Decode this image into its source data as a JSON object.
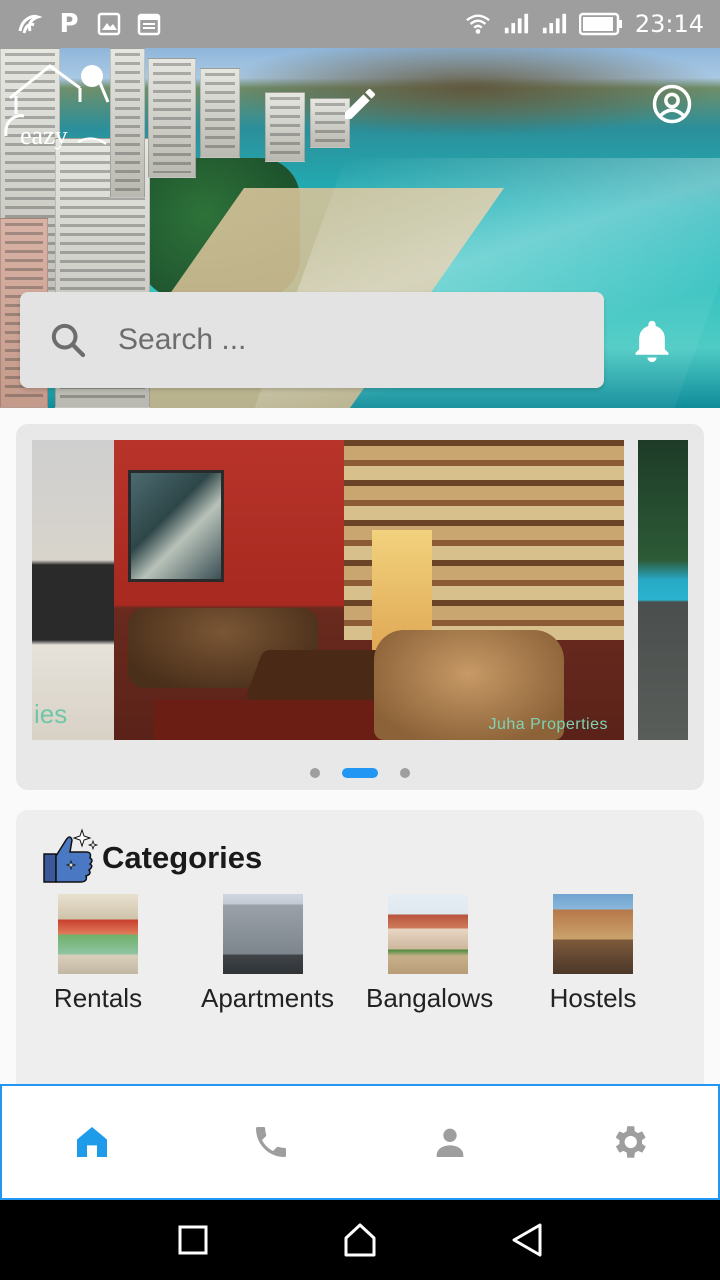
{
  "status_bar": {
    "time": "23:14",
    "left_icons": [
      "app-notification-icon",
      "parking-icon",
      "image-icon",
      "calendar-icon"
    ],
    "right_icons": [
      "wifi-icon",
      "signal-icon",
      "signal-icon-2",
      "battery-icon"
    ],
    "p_glyph": "P"
  },
  "header": {
    "logo_text": "eazy",
    "edit_icon": "pencil-icon",
    "account_icon": "account-circle-icon",
    "notification_icon": "bell-icon"
  },
  "search": {
    "placeholder": "Search ..."
  },
  "carousel": {
    "slides": [
      {
        "watermark": "ies"
      },
      {
        "watermark": "Juha Properties"
      },
      {
        "watermark": ""
      }
    ],
    "active_index": 1,
    "dot_count": 3
  },
  "categories": {
    "title": "Categories",
    "items": [
      {
        "label": "Rentals",
        "thumb": "rentals-thumbnail"
      },
      {
        "label": "Apartments",
        "thumb": "apartments-thumbnail"
      },
      {
        "label": "Bangalows",
        "thumb": "bangalows-thumbnail"
      },
      {
        "label": "Hostels",
        "thumb": "hostels-thumbnail"
      }
    ]
  },
  "bottom_nav": {
    "items": [
      {
        "icon": "home-icon",
        "active": true
      },
      {
        "icon": "phone-icon",
        "active": false
      },
      {
        "icon": "person-icon",
        "active": false
      },
      {
        "icon": "settings-icon",
        "active": false
      }
    ],
    "active_color": "#1e9be9",
    "inactive_color": "#9e9e9e"
  },
  "system_nav": [
    "recents-button",
    "home-button",
    "back-button"
  ],
  "colors": {
    "accent": "#2196f3",
    "status_bar": "#9e9e9e"
  }
}
